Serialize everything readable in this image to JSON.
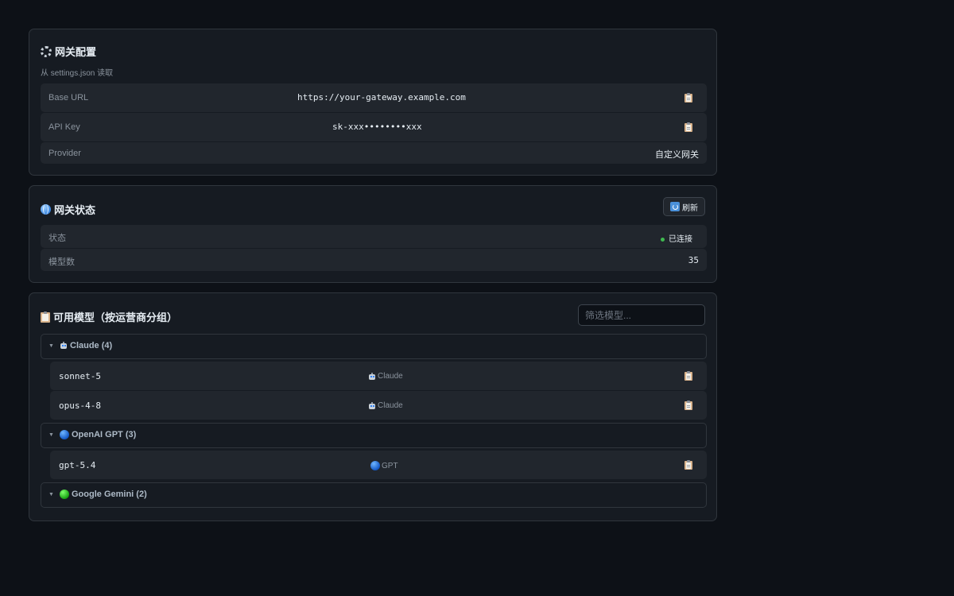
{
  "gateway_config": {
    "icon": "gear-icon",
    "title": "网关配置",
    "subtitle": "从 settings.json 读取",
    "rows": [
      {
        "label": "Base URL",
        "value": "https://your-gateway.example.com",
        "copy_icon": "clipboard-icon"
      },
      {
        "label": "API Key",
        "value": "sk-xxx••••••••xxx",
        "copy_icon": "clipboard-icon"
      },
      {
        "label": "Provider",
        "value": "自定义网关"
      }
    ]
  },
  "gateway_status": {
    "icon": "globe-icon",
    "title": "网关状态",
    "refresh_label": "刷新",
    "refresh_icon": "refresh-icon",
    "status_label": "状态",
    "status_value": "已连接",
    "status_color": "#3fb950",
    "model_count_label": "模型数",
    "model_count_value": "35"
  },
  "models": {
    "icon": "clipboard-icon",
    "title": "可用模型（按运营商分组）",
    "filter_placeholder": "筛选模型...",
    "groups": [
      {
        "name": "Claude (4)",
        "icon": "robot-icon",
        "expanded": true,
        "items": [
          {
            "name": "sonnet-5",
            "tag": "Claude",
            "tag_icon": "robot-icon"
          },
          {
            "name": "opus-4-8",
            "tag": "Claude",
            "tag_icon": "robot-icon"
          }
        ]
      },
      {
        "name": "OpenAI GPT (3)",
        "icon": "blue-circle-icon",
        "expanded": true,
        "items": [
          {
            "name": "gpt-5.4",
            "tag": "GPT",
            "tag_icon": "blue-circle-icon"
          }
        ]
      },
      {
        "name": "Google Gemini (2)",
        "icon": "green-circle-icon",
        "expanded": true,
        "items": []
      }
    ]
  },
  "colors": {
    "background": "#0d1117",
    "card": "#161b22",
    "row": "#21262d",
    "border": "#30363d"
  }
}
